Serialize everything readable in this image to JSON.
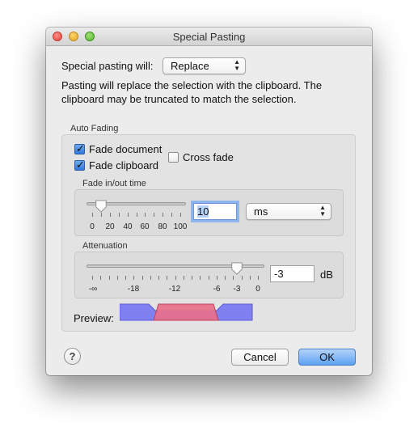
{
  "window": {
    "title": "Special Pasting"
  },
  "mode": {
    "label": "Special pasting will:",
    "value": "Replace",
    "description": "Pasting will replace the selection with the clipboard. The clipboard may be truncated to match the selection."
  },
  "auto_fading": {
    "group_label": "Auto Fading",
    "fade_document": {
      "label": "Fade document",
      "checked": true
    },
    "fade_clipboard": {
      "label": "Fade clipboard",
      "checked": true
    },
    "cross_fade": {
      "label": "Cross fade",
      "checked": false
    },
    "fade_time": {
      "label": "Fade in/out time",
      "value": "10",
      "unit": "ms",
      "ticks": [
        "0",
        "20",
        "40",
        "60",
        "80",
        "100"
      ],
      "slider_value": 10
    },
    "attenuation": {
      "label": "Attenuation",
      "value": "-3",
      "unit": "dB",
      "ticks": [
        "-∞",
        "-18",
        "-12",
        "-6",
        "-3",
        "0"
      ],
      "slider_value": -3
    },
    "preview_label": "Preview:"
  },
  "buttons": {
    "help": "?",
    "cancel": "Cancel",
    "ok": "OK"
  },
  "colors": {
    "accent": "#3b7be0",
    "preview_blue": "#7f7ff2",
    "preview_red": "#e46f84"
  }
}
